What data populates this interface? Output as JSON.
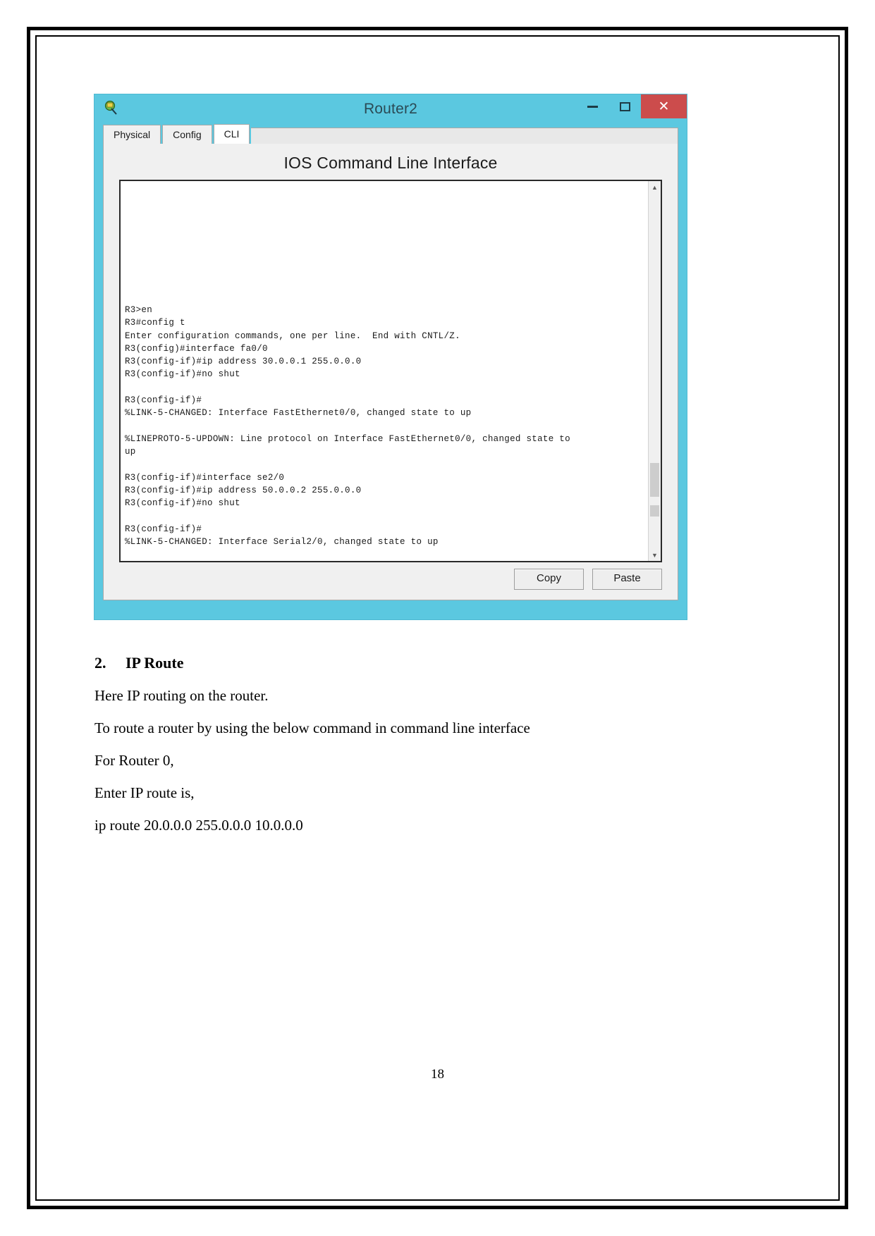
{
  "window": {
    "title": "Router2",
    "icon": "packet-tracer-router-icon",
    "controls": {
      "minimize": "–",
      "maximize": "□",
      "close": "✕"
    },
    "tabs": [
      {
        "label": "Physical",
        "active": false
      },
      {
        "label": "Config",
        "active": false
      },
      {
        "label": "CLI",
        "active": true
      }
    ],
    "heading": "IOS Command Line Interface",
    "console": "R3>en\nR3#config t\nEnter configuration commands, one per line.  End with CNTL/Z.\nR3(config)#interface fa0/0\nR3(config-if)#ip address 30.0.0.1 255.0.0.0\nR3(config-if)#no shut\n\nR3(config-if)#\n%LINK-5-CHANGED: Interface FastEthernet0/0, changed state to up\n\n%LINEPROTO-5-UPDOWN: Line protocol on Interface FastEthernet0/0, changed state to\nup\n\nR3(config-if)#interface se2/0\nR3(config-if)#ip address 50.0.0.2 255.0.0.0\nR3(config-if)#no shut\n\nR3(config-if)#\n%LINK-5-CHANGED: Interface Serial2/0, changed state to up",
    "buttons": {
      "copy": "Copy",
      "paste": "Paste"
    },
    "scrollbar": {
      "up_arrow": "▲",
      "down_arrow": "▼"
    },
    "colors": {
      "titlebar": "#5bc8e0",
      "close_button": "#cc4c4c"
    }
  },
  "document": {
    "heading_number": "2.",
    "heading_text": "IP Route",
    "paragraphs": [
      "Here IP routing on the router.",
      "To route a router by using the below command in command line interface",
      "For Router 0,",
      "Enter IP route is,",
      "ip route 20.0.0.0 255.0.0.0 10.0.0.0"
    ],
    "page_number": "18"
  }
}
